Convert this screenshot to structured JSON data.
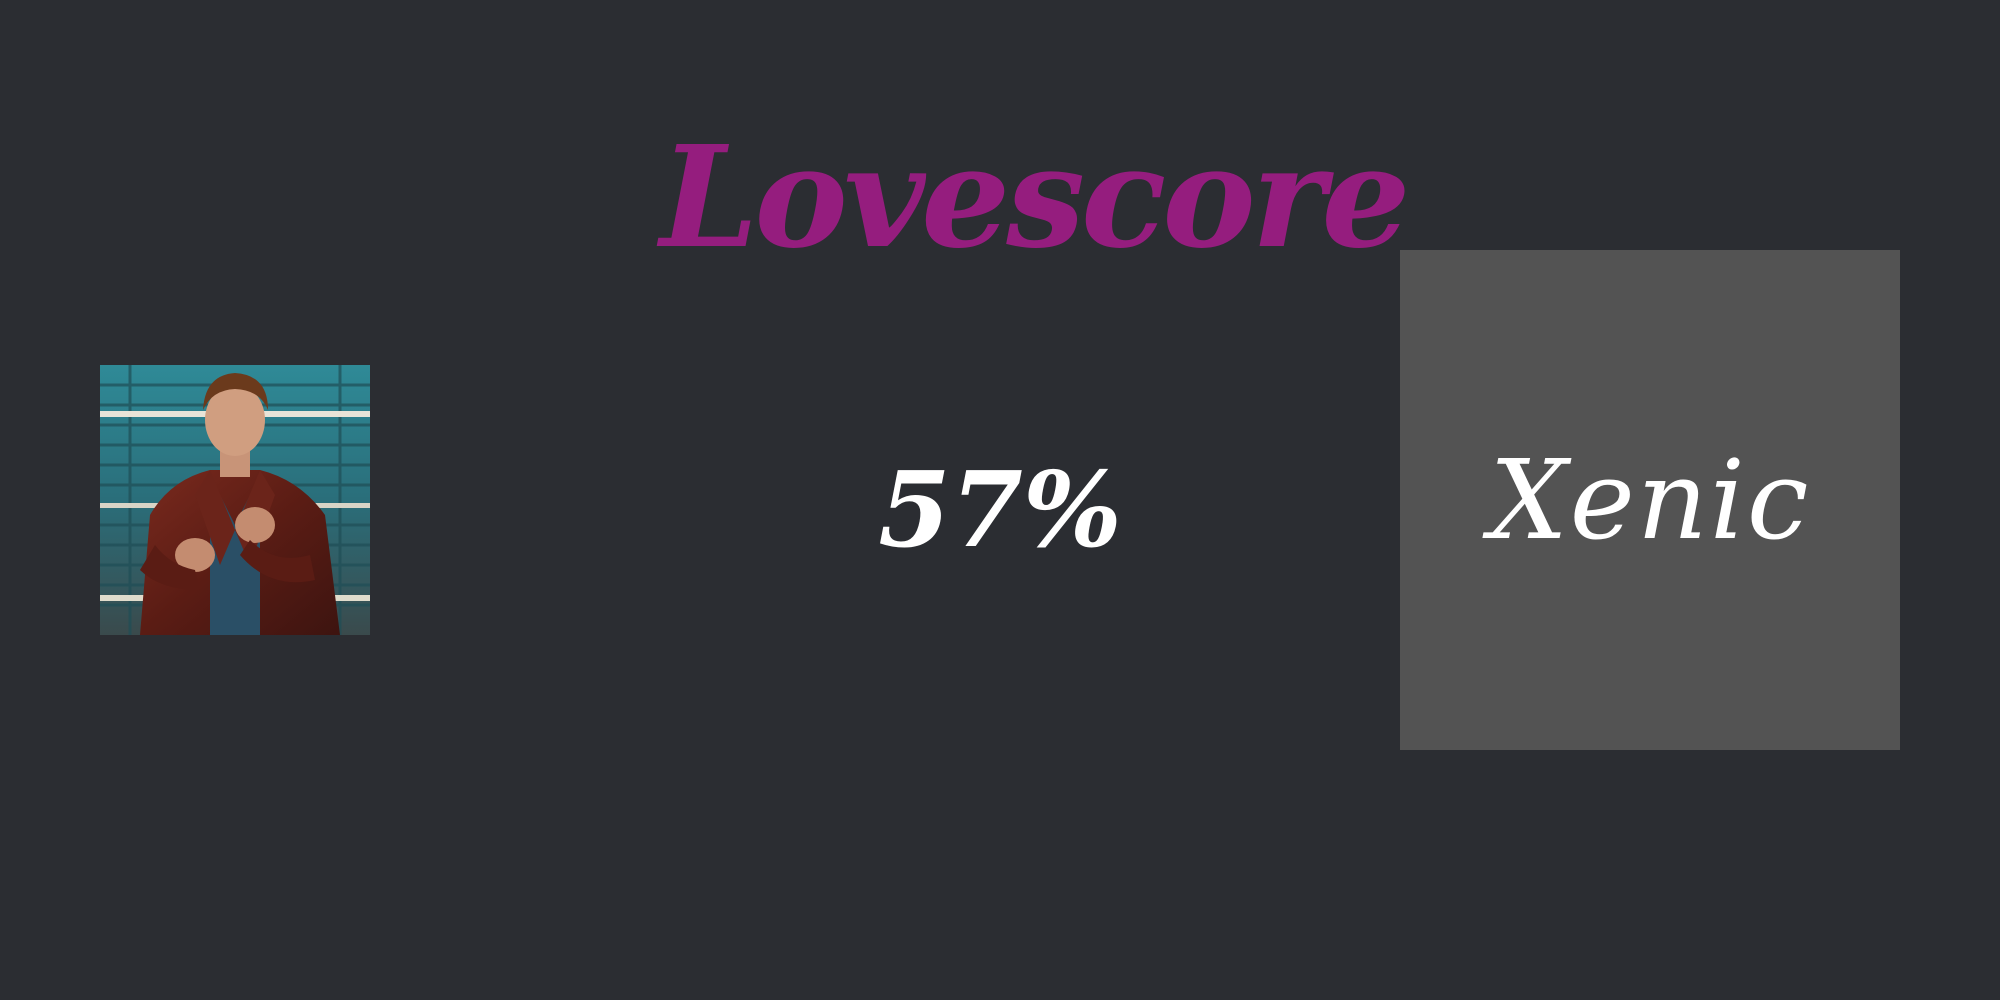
{
  "header": {
    "title": "Lovescore",
    "title_color": "#951d7e"
  },
  "avatar": {
    "description_icon": "person-photo"
  },
  "result": {
    "score": "57%"
  },
  "partner": {
    "name": "Xenic",
    "box_color": "#535353"
  },
  "background_color": "#2b2d32"
}
